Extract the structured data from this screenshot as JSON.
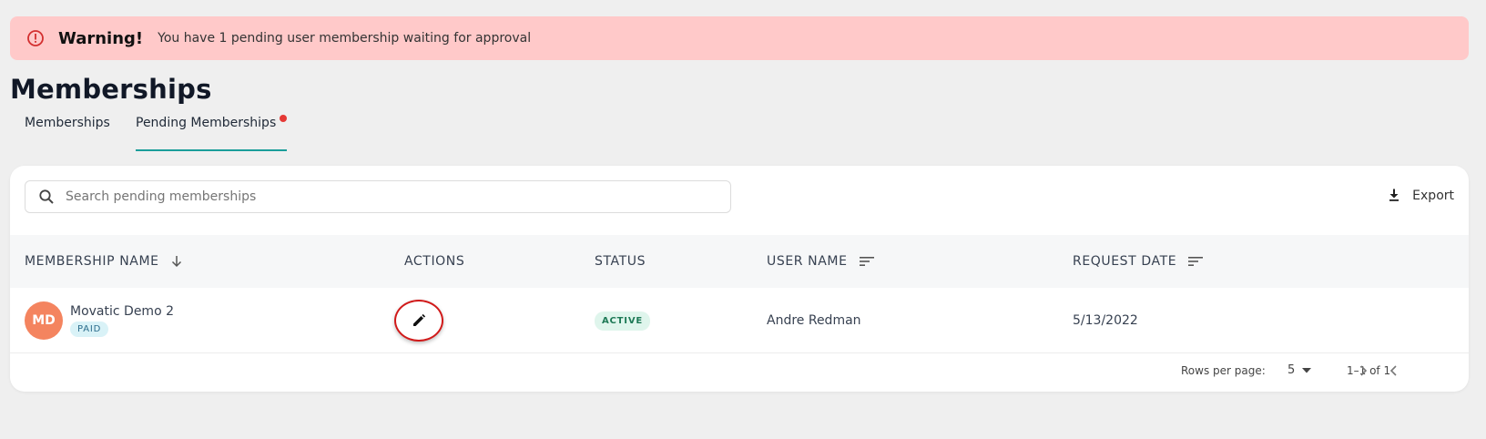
{
  "alert": {
    "title": "Warning!",
    "message": "You have 1 pending user membership waiting for approval",
    "icon": "alert-circle-icon",
    "background": "#ffc9c9",
    "icon_color": "#d32f2f"
  },
  "page": {
    "title": "Memberships"
  },
  "tabs": [
    {
      "label": "Memberships",
      "active": false
    },
    {
      "label": "Pending Memberships",
      "active": true,
      "has_notification_dot": true
    }
  ],
  "toolbar": {
    "search_placeholder": "Search pending memberships",
    "search_value": "",
    "export_label": "Export"
  },
  "table": {
    "columns": [
      {
        "label": "MEMBERSHIP NAME",
        "sort_icon": "arrow-down-icon"
      },
      {
        "label": "ACTIONS"
      },
      {
        "label": "STATUS"
      },
      {
        "label": "USER NAME",
        "sort_icon": "sort-lines-icon"
      },
      {
        "label": "REQUEST DATE",
        "sort_icon": "sort-lines-icon"
      }
    ],
    "rows": [
      {
        "avatar_initials": "MD",
        "avatar_color": "#f4845f",
        "membership_name": "Movatic Demo 2",
        "membership_badge": "PAID",
        "action_icon": "pencil-icon",
        "status": "ACTIVE",
        "user_name": "Andre Redman",
        "request_date": "5/13/2022"
      }
    ]
  },
  "pagination": {
    "rows_per_page_label": "Rows per page:",
    "rows_per_page_value": "5",
    "range": "1–1 of 1"
  },
  "colors": {
    "accent": "#1a9e9a",
    "notification_dot": "#e53935",
    "highlight_ring": "#d11a1a"
  }
}
